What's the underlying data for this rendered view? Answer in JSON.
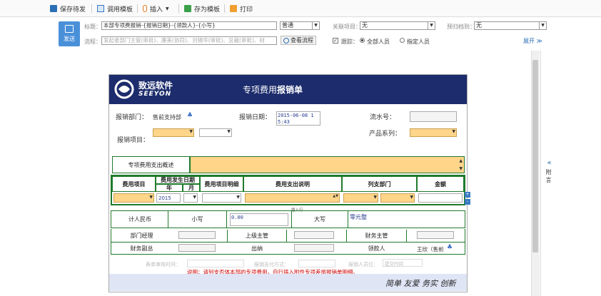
{
  "toolbar": {
    "save_draft": "保存待发",
    "call_template": "调用模板",
    "insert": "插入",
    "save_template": "存为模板",
    "print": "打印"
  },
  "header": {
    "send": "发送",
    "subject_label": "标题：",
    "subject_value": "本部专项费报销-{报销日期}-{领款人}-{小写}",
    "priority": "普通",
    "related_label": "关联项目：",
    "related_value": "无",
    "archive_label": "预归档到：",
    "archive_value": "无",
    "flow_label": "流程：",
    "flow_placeholder": "发起者部门主管(审批)、廉美(协同)、刘锡华(审批)、总裁(审批)、材",
    "view_flow": "查看流程",
    "track_label": "跟踪：",
    "all_people": "全部人员",
    "specified_people": "指定人员",
    "expand": "展开"
  },
  "side": {
    "attach": "附言"
  },
  "form": {
    "logo_cn": "致远软件",
    "logo_en": "SEEYON",
    "title_prefix": "专项费用",
    "title_bold": "报销单",
    "dept_label": "报销部门：",
    "dept_value": "售前支持部",
    "date_label": "报销日期：",
    "date_value": "2015-06-08 15:43",
    "serial_label": "流水号：",
    "item_label": "报销项目：",
    "product_label": "产品系列：",
    "summary_label": "专项费用支出概述",
    "col_item": "费用项目",
    "col_date": "费用发生日期",
    "col_year": "年",
    "col_month": "月",
    "col_detail": "费用项目明细",
    "col_desc": "费用支出说明",
    "col_dept": "列支部门",
    "col_amount": "金额",
    "year_value": "2015",
    "insert_label": "插入行",
    "rmb_label": "计人民币",
    "small_label": "小写",
    "small_value": "0.00",
    "big_label": "大写",
    "big_value": "零元整",
    "dept_manager": "部门经理",
    "upper_manager": "上级主管",
    "finance_manager": "财务主管",
    "finance_deputy": "财务副总",
    "cashier": "出纳",
    "payee": "领款人",
    "payee_value": "王欣（售前",
    "audit_time": "表单审核时间：",
    "pay_method": "报销支付方式：",
    "reimburser": "报销人员位：",
    "submit_time": "提交时间",
    "notice": "说明：请列支否体本部的专项费用，自行插入附件专项差旅报销单明细。",
    "slogan": "简单 友爱 务实 创新"
  }
}
